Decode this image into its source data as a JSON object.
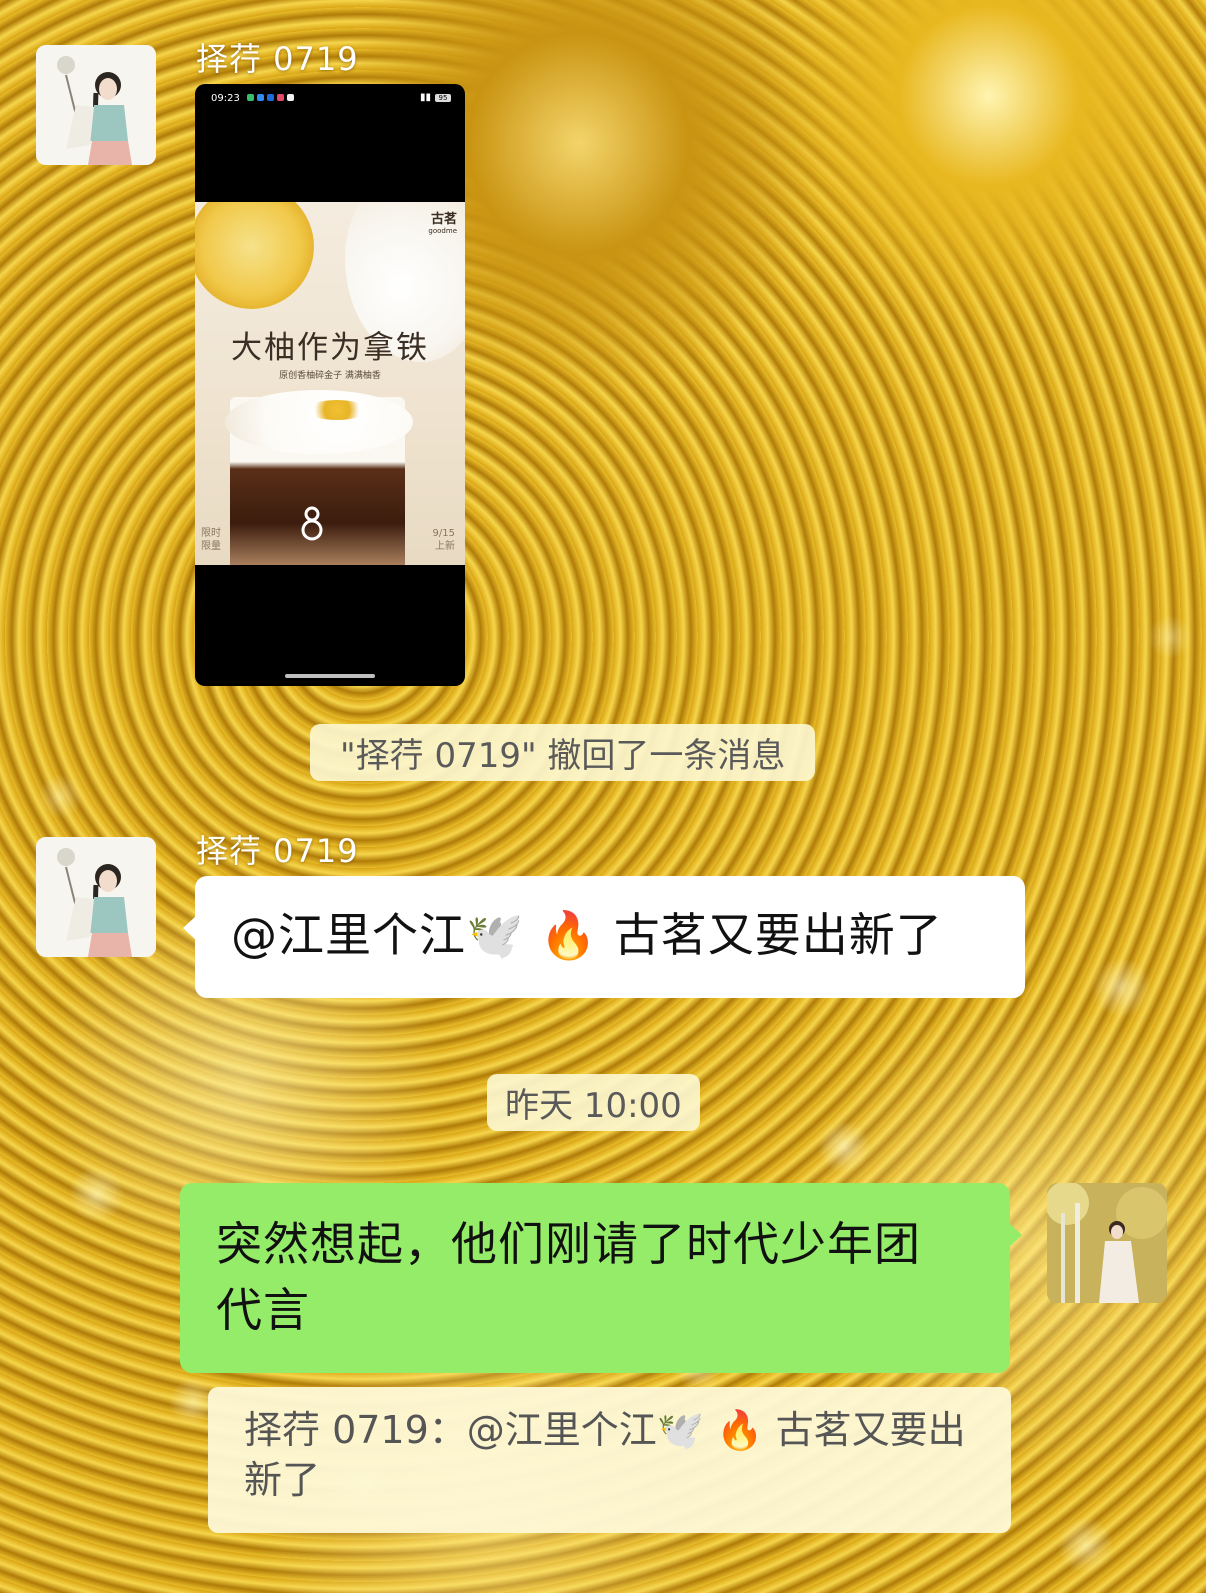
{
  "chat": {
    "messages": [
      {
        "sender": "择荇 0719",
        "type": "image",
        "screenshot": {
          "status_time": "09:23",
          "battery": "95",
          "poster": {
            "brand_cn": "古茗",
            "brand_en": "goodme",
            "title": "大柚作为拿铁",
            "subtitle": "原创香柚碎金子  满满柚香",
            "left_note_1": "限时",
            "left_note_2": "限量",
            "right_note_1": "9/15",
            "right_note_2": "上新"
          }
        }
      },
      {
        "type": "system",
        "text": "\"择荇 0719\" 撤回了一条消息"
      },
      {
        "sender": "择荇 0719",
        "type": "text",
        "text": "@江里个江🕊️ 🔥 古茗又要出新了"
      },
      {
        "type": "timestamp",
        "text": "昨天 10:00"
      },
      {
        "type": "text",
        "outgoing": true,
        "text_line1": "突然想起，他们刚请了时代少年团",
        "text_line2": "代言",
        "quote": "择荇 0719：@江里个江🕊️ 🔥 古茗又要出新了"
      }
    ]
  },
  "colors": {
    "outgoing_bubble": "#95ec69",
    "incoming_bubble": "#ffffff",
    "notice_bg": "#fcf6ce"
  }
}
